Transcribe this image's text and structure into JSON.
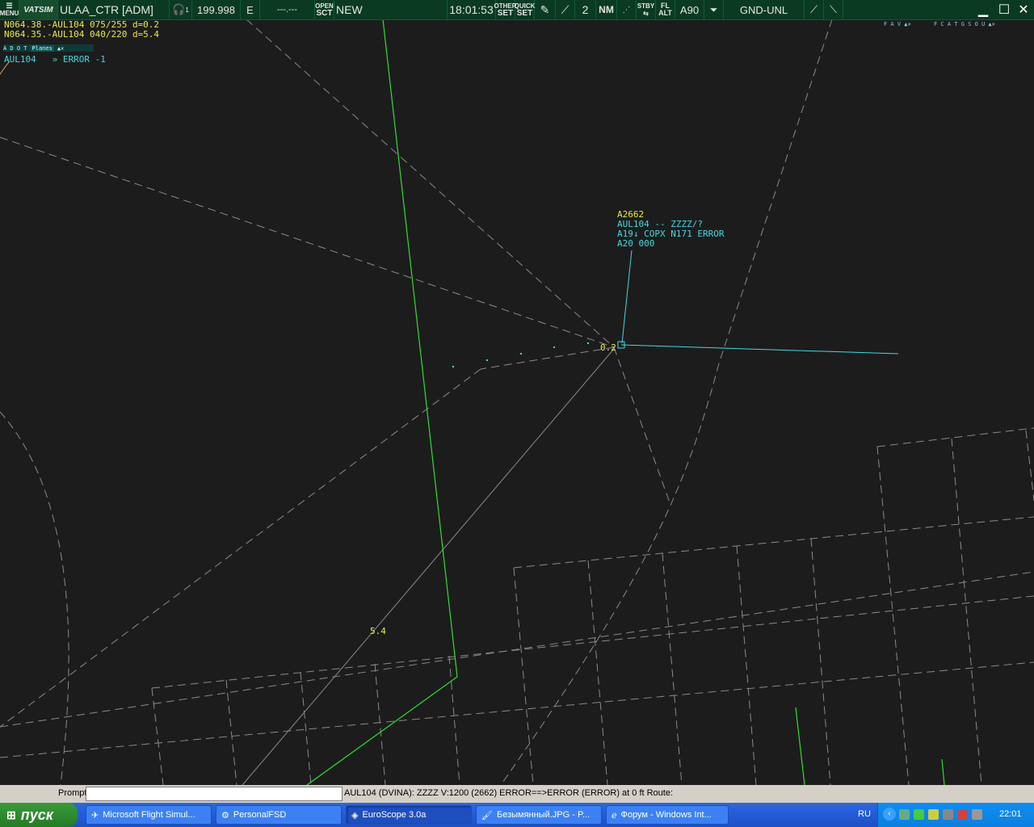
{
  "toolbar": {
    "menu_label": "MENU",
    "logo": "VATSIM",
    "callsign": "ULAA_CTR [ADM]",
    "headset_sub": "1",
    "frequency": "199.998",
    "atis_letter": "E",
    "secondary_freq": "---.---",
    "open_label": "OPEN",
    "sct_label": "SCT",
    "new_label": "NEW",
    "time": "18:01:53",
    "other_label": "OTHER",
    "quick_label": "QUICK",
    "set_label": "SET",
    "range_number": "2",
    "nm_label": "NM",
    "stby_label": "STBY",
    "fl_label": "FL",
    "alt_label": "ALT",
    "altitude_filter": "A90",
    "gnd_unl": "GND-UNL"
  },
  "overlay": {
    "line1": "N064.38.-AUL104 075/255 d=0.2",
    "line2": "N064.35.-AUL104 040/220 d=5.4",
    "list_tabs": "A D O T",
    "list_name": "Planes",
    "list_row": "AUL104   » ERROR -1",
    "right_tabs_1": "F A V",
    "right_tabs_2": "F C A T G S O U"
  },
  "target": {
    "squawk": "A2662",
    "line2": "AUL104 -- ZZZZ/?",
    "line3": "A19↓ COPX N171 ERROR",
    "line4": "A20 000",
    "distance_near": "0.2",
    "distance_far": "5.4"
  },
  "command": {
    "prompt_label": "Prompt",
    "prompt_value": "",
    "status": "AUL104 (DVINA): ZZZZ V:1200 (2662) ERROR==>ERROR (ERROR) at 0 ft Route:"
  },
  "taskbar": {
    "start_label": "пуск",
    "tasks": [
      "Microsoft Flight Simul...",
      "PersonalFSD",
      "EuroScope 3.0a",
      "Безымянный.JPG - P...",
      "Форум - Windows Int..."
    ],
    "lang": "RU",
    "clock": "22:01"
  },
  "colors": {
    "radar_bg": "#1c1c1c",
    "toolbar": "#0a3a22",
    "label_yellow": "#e8e84a",
    "label_cyan": "#46d8e0",
    "route_green": "#2ee02e",
    "sector_gray": "#8a8a8a"
  }
}
